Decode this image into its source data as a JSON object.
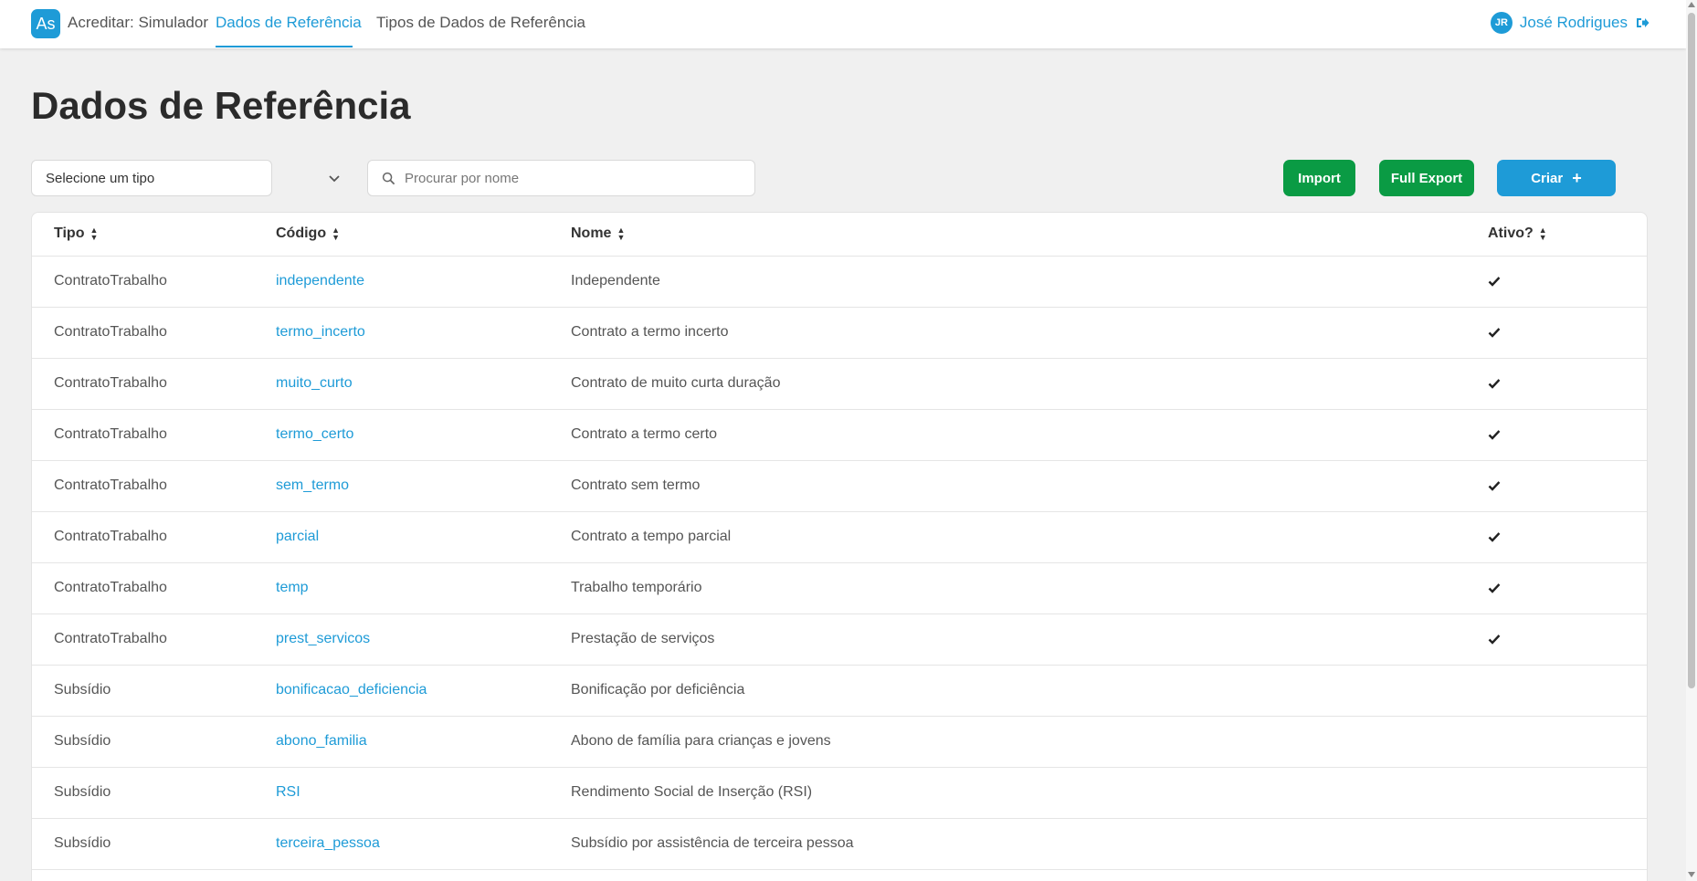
{
  "colors": {
    "accent": "#1e9bd7",
    "success": "#0a9b44",
    "background": "#f0f0f0"
  },
  "nav": {
    "logo_text": "As",
    "brand": "Acreditar: Simulador",
    "links": [
      "Dados de Referência",
      "Tipos de Dados de Referência"
    ],
    "active_link": "Dados de Referência",
    "user_initials": "JR",
    "user_name": "José Rodrigues",
    "logout_icon": "sign-out-icon"
  },
  "page": {
    "title": "Dados de Referência"
  },
  "filters": {
    "select_value": "Selecione um tipo",
    "search_placeholder": "Procurar por nome",
    "search_value": ""
  },
  "actions": {
    "import": "Import",
    "export": "Full Export",
    "create": "Criar"
  },
  "table": {
    "headers": [
      "Tipo",
      "Código",
      "Nome",
      "Ativo?"
    ],
    "rows": [
      {
        "tipo": "ContratoTrabalho",
        "codigo": "independente",
        "nome": "Independente",
        "ativo": true
      },
      {
        "tipo": "ContratoTrabalho",
        "codigo": "termo_incerto",
        "nome": "Contrato a termo incerto",
        "ativo": true
      },
      {
        "tipo": "ContratoTrabalho",
        "codigo": "muito_curto",
        "nome": "Contrato de muito curta duração",
        "ativo": true
      },
      {
        "tipo": "ContratoTrabalho",
        "codigo": "termo_certo",
        "nome": "Contrato a termo certo",
        "ativo": true
      },
      {
        "tipo": "ContratoTrabalho",
        "codigo": "sem_termo",
        "nome": "Contrato sem termo",
        "ativo": true
      },
      {
        "tipo": "ContratoTrabalho",
        "codigo": "parcial",
        "nome": "Contrato a tempo parcial",
        "ativo": true
      },
      {
        "tipo": "ContratoTrabalho",
        "codigo": "temp",
        "nome": "Trabalho temporário",
        "ativo": true
      },
      {
        "tipo": "ContratoTrabalho",
        "codigo": "prest_servicos",
        "nome": "Prestação de serviços",
        "ativo": true
      },
      {
        "tipo": "Subsídio",
        "codigo": "bonificacao_deficiencia",
        "nome": "Bonificação por deficiência",
        "ativo": false
      },
      {
        "tipo": "Subsídio",
        "codigo": "abono_familia",
        "nome": "Abono de família para crianças e jovens",
        "ativo": false
      },
      {
        "tipo": "Subsídio",
        "codigo": "RSI",
        "nome": "Rendimento Social de Inserção (RSI)",
        "ativo": false
      },
      {
        "tipo": "Subsídio",
        "codigo": "terceira_pessoa",
        "nome": "Subsídio por assistência de terceira pessoa",
        "ativo": false
      }
    ]
  }
}
